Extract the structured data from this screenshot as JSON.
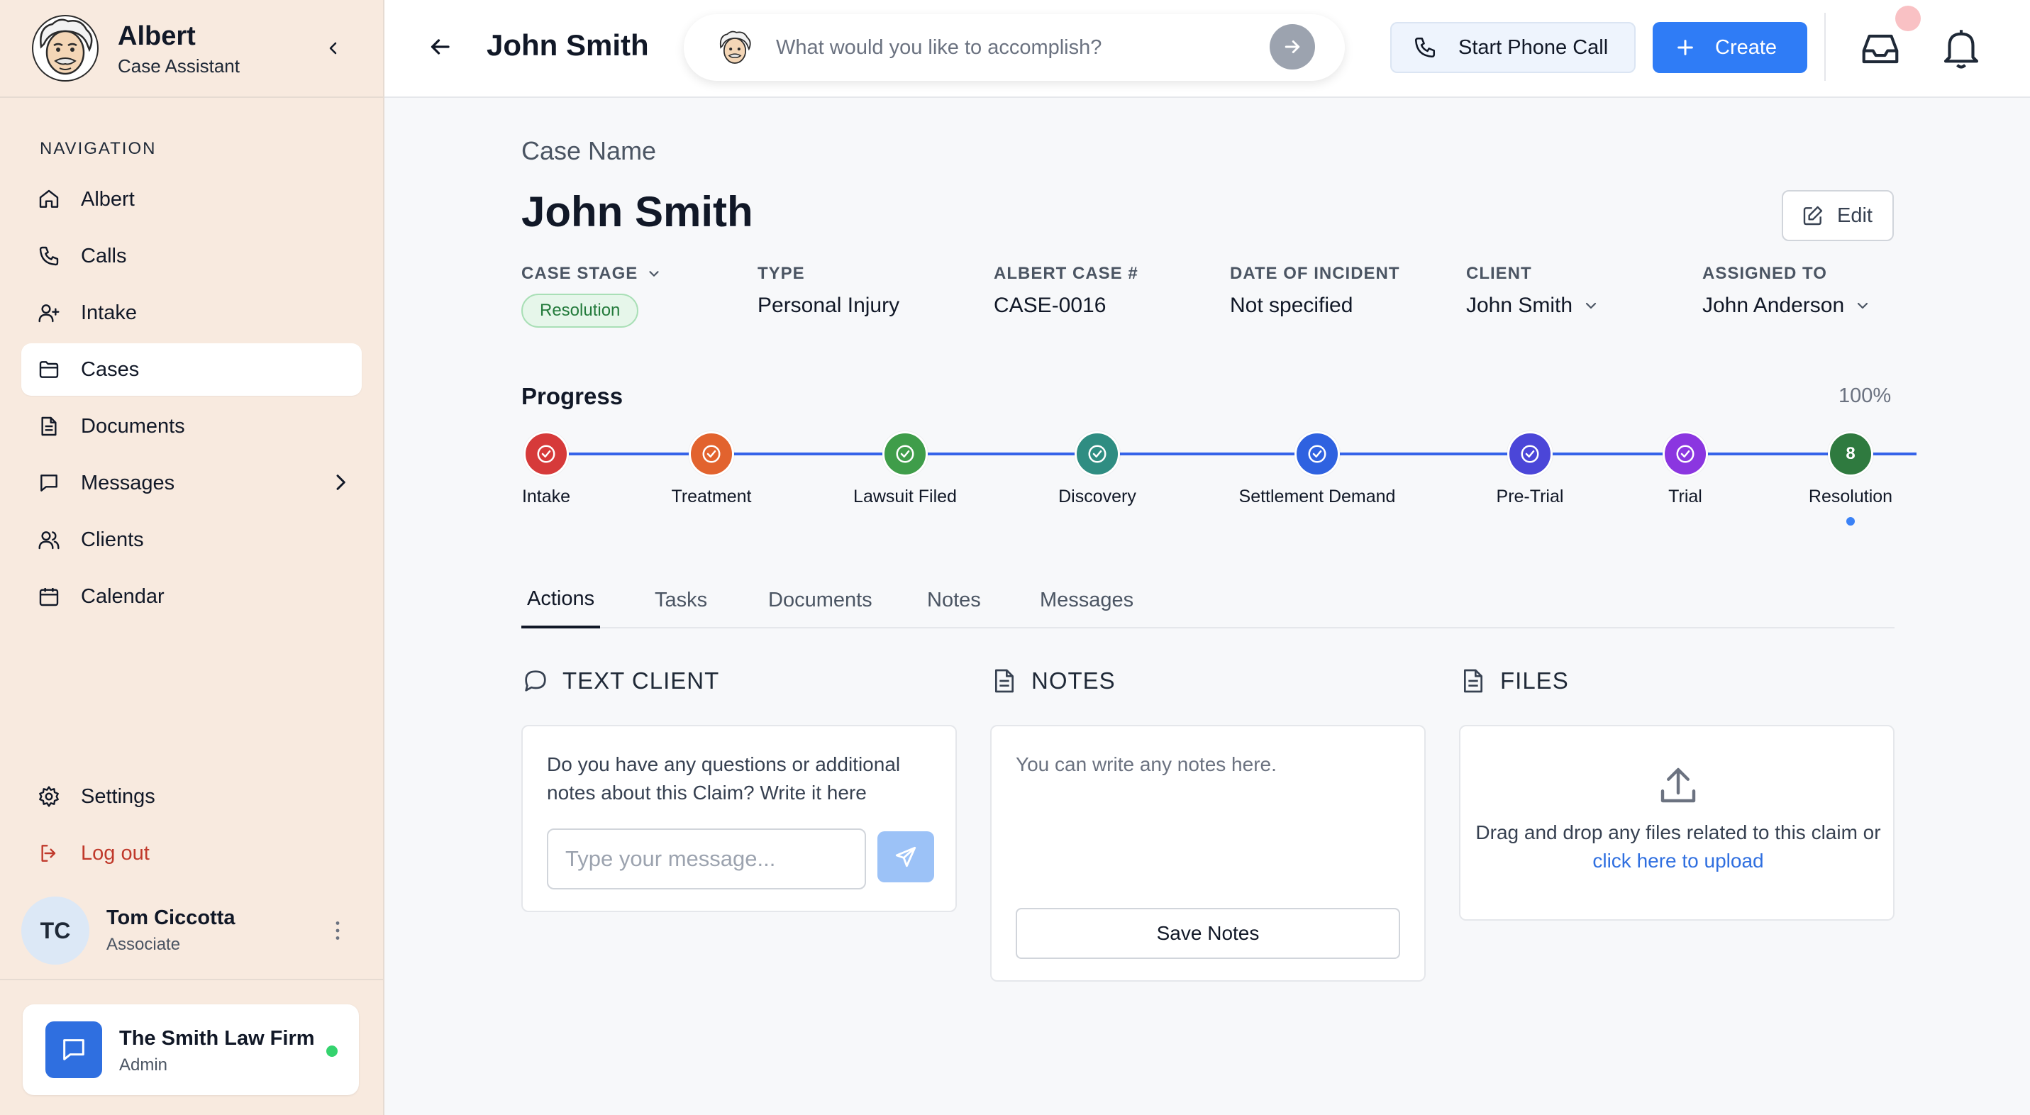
{
  "app": {
    "name": "Albert",
    "subtitle": "Case Assistant"
  },
  "sidebar": {
    "nav_heading": "NAVIGATION",
    "items": [
      {
        "label": "Albert",
        "icon": "home-icon",
        "active": false
      },
      {
        "label": "Calls",
        "icon": "phone-icon",
        "active": false
      },
      {
        "label": "Intake",
        "icon": "user-plus-icon",
        "active": false
      },
      {
        "label": "Cases",
        "icon": "folder-icon",
        "active": true
      },
      {
        "label": "Documents",
        "icon": "document-icon",
        "active": false
      },
      {
        "label": "Messages",
        "icon": "message-icon",
        "active": false,
        "has_submenu": true
      },
      {
        "label": "Clients",
        "icon": "users-icon",
        "active": false
      },
      {
        "label": "Calendar",
        "icon": "calendar-icon",
        "active": false
      }
    ],
    "settings_label": "Settings",
    "logout_label": "Log out",
    "user": {
      "initials": "TC",
      "name": "Tom Ciccotta",
      "role": "Associate"
    },
    "firm": {
      "name": "The Smith Law Firm",
      "role": "Admin",
      "status_color": "#34d36e"
    }
  },
  "topbar": {
    "title": "John Smith",
    "search_placeholder": "What would you like to accomplish?",
    "phone_button": "Start Phone Call",
    "create_button": "Create",
    "accent": "#2f7cf6"
  },
  "case": {
    "label": "Case Name",
    "name": "John Smith",
    "edit_label": "Edit",
    "fields": {
      "stage_label": "CASE STAGE",
      "stage_value": "Resolution",
      "type_label": "TYPE",
      "type_value": "Personal Injury",
      "number_label": "ALBERT CASE #",
      "number_value": "CASE-0016",
      "incident_label": "DATE OF INCIDENT",
      "incident_value": "Not specified",
      "client_label": "CLIENT",
      "client_value": "John Smith",
      "assigned_label": "ASSIGNED TO",
      "assigned_value": "John Anderson"
    }
  },
  "progress": {
    "title": "Progress",
    "percent": "100%",
    "steps": [
      {
        "label": "Intake",
        "color": "#d63a3a",
        "done": true
      },
      {
        "label": "Treatment",
        "color": "#e2632e",
        "done": true
      },
      {
        "label": "Lawsuit Filed",
        "color": "#3f9d4a",
        "done": true
      },
      {
        "label": "Discovery",
        "color": "#2f8d82",
        "done": true
      },
      {
        "label": "Settlement Demand",
        "color": "#2f62e0",
        "done": true
      },
      {
        "label": "Pre-Trial",
        "color": "#4b46d8",
        "done": true
      },
      {
        "label": "Trial",
        "color": "#8b36e0",
        "done": true
      },
      {
        "label": "Resolution",
        "color": "#2f7a3f",
        "done": false,
        "number": "8",
        "current": true
      }
    ]
  },
  "tabs": [
    {
      "label": "Actions",
      "active": true
    },
    {
      "label": "Tasks",
      "active": false
    },
    {
      "label": "Documents",
      "active": false
    },
    {
      "label": "Notes",
      "active": false
    },
    {
      "label": "Messages",
      "active": false
    }
  ],
  "panels": {
    "text_client": {
      "title": "TEXT CLIENT",
      "prompt": "Do you have any questions or additional notes about this Claim? Write it here",
      "input_placeholder": "Type your message..."
    },
    "notes": {
      "title": "NOTES",
      "placeholder": "You can write any notes here.",
      "save_label": "Save Notes"
    },
    "files": {
      "title": "FILES",
      "text": "Drag and drop any files related to this claim or ",
      "link": "click here to upload"
    }
  }
}
